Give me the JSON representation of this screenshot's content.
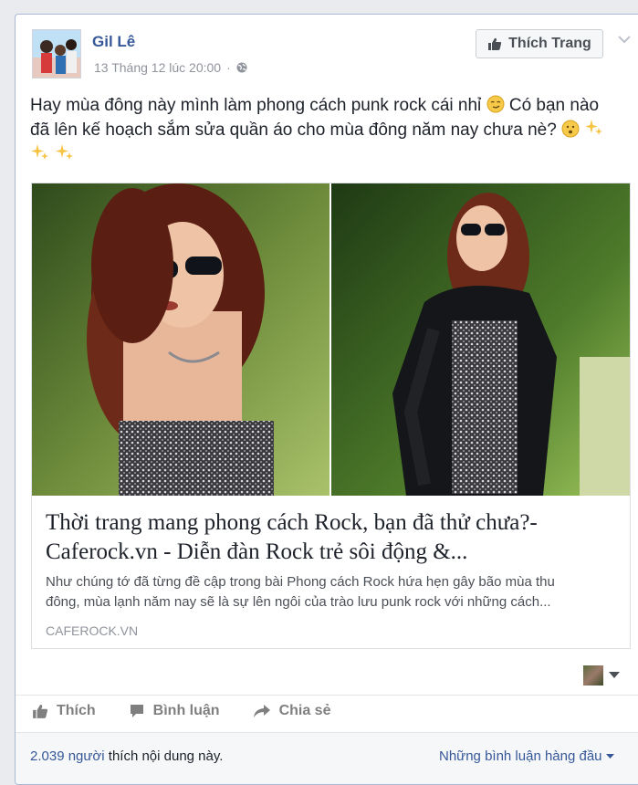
{
  "post": {
    "author": "Gil Lê",
    "timestamp": "13 Tháng 12 lúc 20:00",
    "privacy_icon": "globe-icon",
    "like_page_label": "Thích Trang",
    "text_line1": "Hay mùa đông này mình làm phong cách punk rock cái nhỉ",
    "text_line1b": " Có bạn nào",
    "text_line2": "đã lên kế hoạch sắm sửa quần áo cho mùa đông năm nay chưa nè?"
  },
  "link": {
    "title_line1": "Thời trang mang phong cách Rock, bạn đã thử chưa?-",
    "title_line2": "Caferock.vn - Diễn đàn Rock trẻ sôi động &...",
    "desc_line1": "Như chúng tớ đã từng đề cập trong bài Phong cách Rock hứa hẹn gây bão mùa thu",
    "desc_line2": "đông, mùa lạnh năm nay sẽ là sự lên ngôi của trào lưu punk rock với những cách...",
    "domain": "CAFEROCK.VN"
  },
  "actions": {
    "like": "Thích",
    "comment": "Bình luận",
    "share": "Chia sẻ"
  },
  "footer": {
    "likes_number": "2.039 người",
    "likes_suffix": " thích nội dung này.",
    "top_comments": "Những bình luận hàng đầu"
  },
  "colors": {
    "link_blue": "#365899",
    "text": "#1d2129",
    "muted": "#90949c"
  }
}
